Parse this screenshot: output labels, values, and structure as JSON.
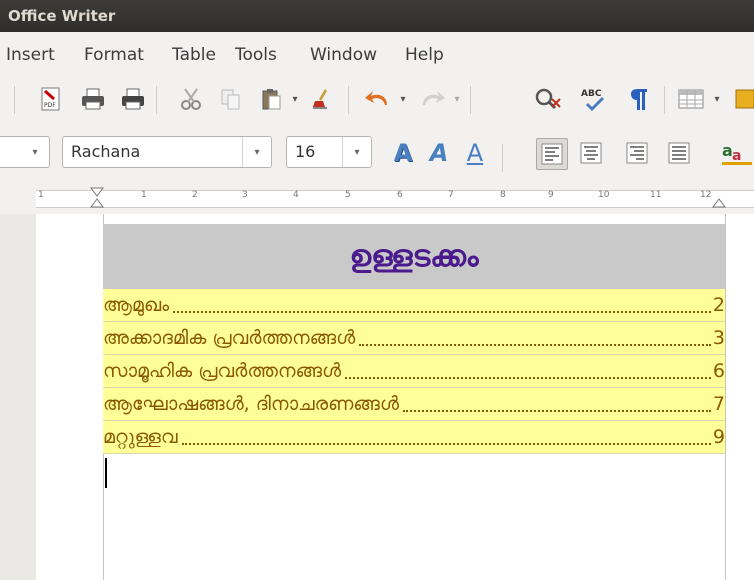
{
  "window": {
    "title": "Office Writer"
  },
  "menu": [
    "Insert",
    "Format",
    "Table",
    "Tools",
    "Window",
    "Help"
  ],
  "toolbar": {
    "icons": [
      "pdf-icon",
      "print-icon",
      "print-preview-icon",
      "cut-icon",
      "copy-icon",
      "paste-icon",
      "dropdown-arrow-icon",
      "clone-format-icon",
      "undo-icon",
      "dropdown-arrow-icon",
      "redo-icon",
      "dropdown-arrow-icon",
      "find-icon",
      "spellcheck-icon",
      "pilcrow-icon",
      "table-icon",
      "dropdown-arrow-icon"
    ],
    "spellcheck_label": "ABC"
  },
  "formatting": {
    "font_name": "Rachana",
    "font_size": "16",
    "font_size_arrow": "▾",
    "font_name_arrow": "▾",
    "style_arrow": "▾",
    "bold": "A",
    "italic": "A",
    "underline": "A"
  },
  "ruler": {
    "numbers": [
      "1",
      "1",
      "2",
      "3",
      "4",
      "5",
      "6",
      "7",
      "8",
      "9",
      "10",
      "11",
      "12"
    ]
  },
  "document": {
    "heading": "ഉള്ളടക്കം",
    "toc": [
      {
        "label": "ആമുഖം",
        "page": "2"
      },
      {
        "label": "അക്കാദമിക പ്രവർത്തനങ്ങൾ",
        "page": "3"
      },
      {
        "label": "സാമൂഹിക പ്രവർത്തനങ്ങൾ",
        "page": "6"
      },
      {
        "label": "ആഘോഷങ്ങൾ, ദിനാചരണങ്ങൾ",
        "page": "7"
      },
      {
        "label": "മറ്റുള്ളവ",
        "page": "9"
      }
    ]
  }
}
